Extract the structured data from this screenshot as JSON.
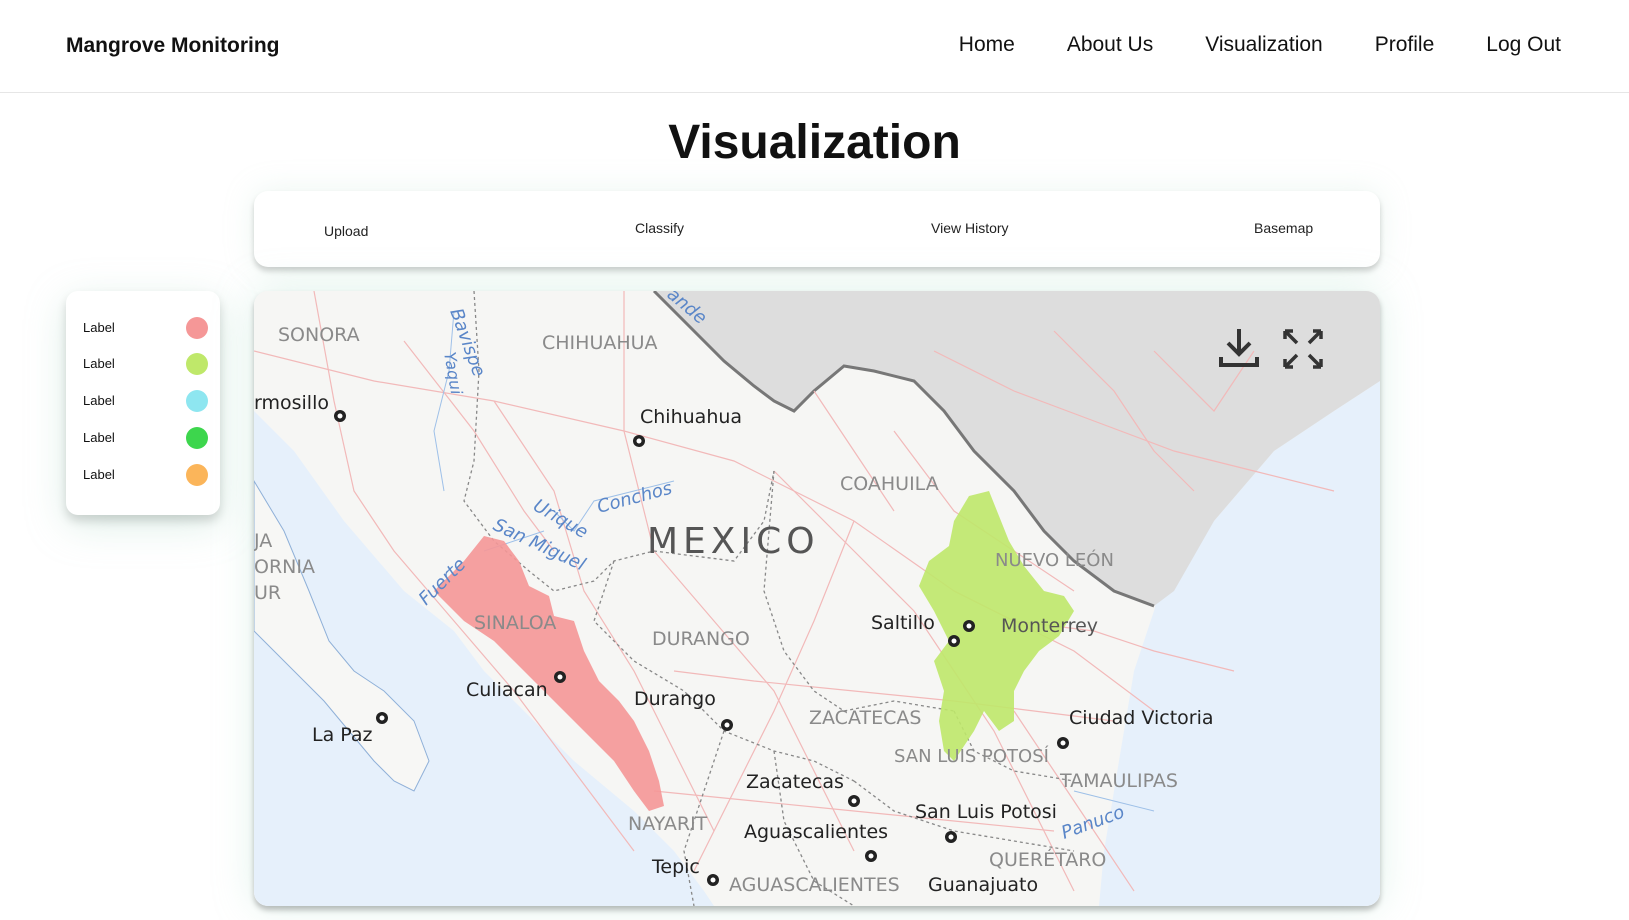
{
  "nav": {
    "brand": "Mangrove Monitoring",
    "links": [
      "Home",
      "About Us",
      "Visualization",
      "Profile",
      "Log Out"
    ]
  },
  "page": {
    "title": "Visualization"
  },
  "toolbar": {
    "upload": "Upload",
    "classify": "Classify",
    "view_history": "View History",
    "basemap": "Basemap"
  },
  "legend": {
    "items": [
      {
        "label": "Label",
        "color": "#f59797"
      },
      {
        "label": "Label",
        "color": "#bfe86a"
      },
      {
        "label": "Label",
        "color": "#8ee6f0"
      },
      {
        "label": "Label",
        "color": "#3dd64d"
      },
      {
        "label": "Label",
        "color": "#fbb55a"
      }
    ]
  },
  "map": {
    "controls": {
      "download_icon": "download-icon",
      "fullscreen_icon": "fullscreen-icon"
    },
    "country": "MEXICO",
    "states": [
      "SONORA",
      "CHIHUAHUA",
      "COAHUILA",
      "NUEVO LEÓN",
      "SINALOA",
      "DURANGO",
      "ZACATECAS",
      "SAN LUIS POTOSÍ",
      "TAMAULIPAS",
      "NAYARIT",
      "AGUASCALIENTES",
      "QUERÉTARO",
      "JA",
      "ORNIA",
      "UR"
    ],
    "cities": [
      "rmosillo",
      "Chihuahua",
      "Saltillo",
      "Monterrey",
      "Culiacan",
      "Durango",
      "La Paz",
      "Ciudad Victoria",
      "Zacatecas",
      "San Luis Potosi",
      "Aguascalientes",
      "Tepic",
      "Guanajuato"
    ],
    "rivers": [
      "Bavispe",
      "Yaqui",
      "Conchos",
      "Urique",
      "San Miguel",
      "Fuerte",
      "Panuco",
      "ande"
    ],
    "highlight_colors": {
      "sinaloa": "#f59797",
      "nuevo_leon": "#bfe86a"
    }
  }
}
